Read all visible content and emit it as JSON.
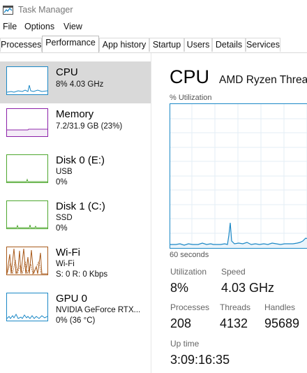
{
  "window": {
    "title": "Task Manager",
    "icon": "task-manager-icon"
  },
  "menu": [
    "File",
    "Options",
    "View"
  ],
  "tabs": [
    "Processes",
    "Performance",
    "App history",
    "Startup",
    "Users",
    "Details",
    "Services"
  ],
  "active_tab": "Performance",
  "sidebar": [
    {
      "title": "CPU",
      "line1": "8% 4.03 GHz",
      "line2": "",
      "line3": "",
      "color": "#1b88c6",
      "selected": true
    },
    {
      "title": "Memory",
      "line1": "7.2/31.9 GB (23%)",
      "line2": "",
      "line3": "",
      "color": "#8b20a8",
      "selected": false
    },
    {
      "title": "Disk 0 (E:)",
      "line1": "USB",
      "line2": "0%",
      "line3": "",
      "color": "#4ea72e",
      "selected": false
    },
    {
      "title": "Disk 1 (C:)",
      "line1": "SSD",
      "line2": "0%",
      "line3": "",
      "color": "#4ea72e",
      "selected": false
    },
    {
      "title": "Wi-Fi",
      "line1": "Wi-Fi",
      "line2": "S: 0 R: 0 Kbps",
      "line3": "",
      "color": "#a85a1b",
      "selected": false
    },
    {
      "title": "GPU 0",
      "line1": "NVIDIA GeForce RTX...",
      "line2": "0% (36 °C)",
      "line3": "",
      "color": "#1b88c6",
      "selected": false
    }
  ],
  "main": {
    "title": "CPU",
    "subtitle": "AMD Ryzen Threa",
    "chart_label_top": "% Utilization",
    "chart_label_bottom": "60 seconds",
    "stats": {
      "utilization_label": "Utilization",
      "utilization_value": "8%",
      "speed_label": "Speed",
      "speed_value": "4.03 GHz",
      "processes_label": "Processes",
      "processes_value": "208",
      "threads_label": "Threads",
      "threads_value": "4132",
      "handles_label": "Handles",
      "handles_value": "95689",
      "uptime_label": "Up time",
      "uptime_value": "3:09:16:35"
    }
  },
  "colors": {
    "cpu": "#1b88c6",
    "memory": "#8b20a8",
    "disk": "#4ea72e",
    "wifi": "#a85a1b",
    "selected_bg": "#d9d9d9"
  }
}
